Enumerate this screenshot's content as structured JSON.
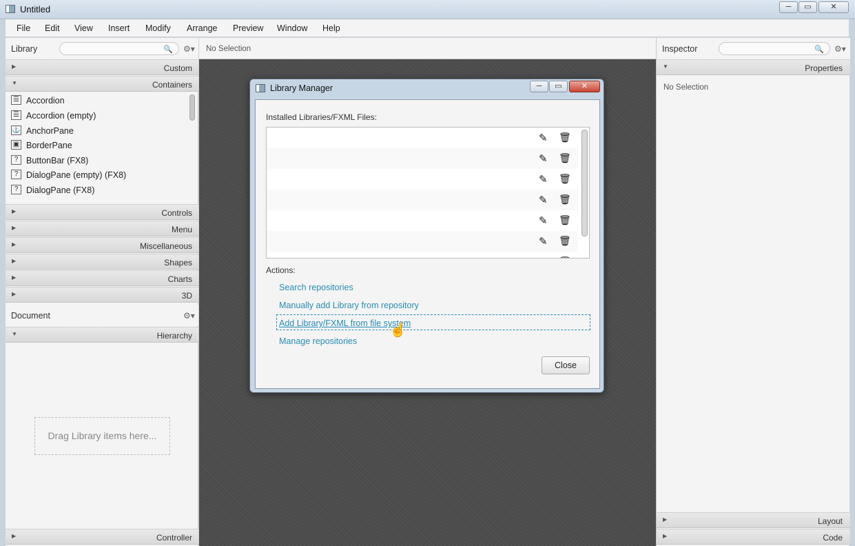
{
  "window": {
    "title": "Untitled",
    "minimize_glyph": "─",
    "maximize_glyph": "▭",
    "close_glyph": "✕"
  },
  "menubar": [
    "File",
    "Edit",
    "View",
    "Insert",
    "Modify",
    "Arrange",
    "Preview",
    "Window",
    "Help"
  ],
  "library": {
    "title": "Library",
    "search_placeholder": "",
    "sections": {
      "custom": "Custom",
      "containers": "Containers",
      "controls": "Controls",
      "menu": "Menu",
      "miscellaneous": "Miscellaneous",
      "shapes": "Shapes",
      "charts": "Charts",
      "threed": "3D"
    },
    "items": [
      {
        "icon": "accordion-icon",
        "glyph": "☰",
        "label": "Accordion"
      },
      {
        "icon": "accordion-icon",
        "glyph": "☰",
        "label": "Accordion  (empty)"
      },
      {
        "icon": "anchor-icon",
        "glyph": "⚓",
        "label": "AnchorPane"
      },
      {
        "icon": "borderpane-icon",
        "glyph": "▣",
        "label": "BorderPane"
      },
      {
        "icon": "unknown-icon",
        "glyph": "?",
        "label": "ButtonBar  (FX8)"
      },
      {
        "icon": "unknown-icon",
        "glyph": "?",
        "label": "DialogPane (empty)  (FX8)"
      },
      {
        "icon": "unknown-icon",
        "glyph": "?",
        "label": "DialogPane  (FX8)"
      }
    ]
  },
  "document": {
    "title": "Document",
    "hierarchy": "Hierarchy",
    "drop_hint": "Drag Library items here...",
    "controller": "Controller"
  },
  "center": {
    "selection": "No Selection"
  },
  "inspector": {
    "title": "Inspector",
    "properties": "Properties",
    "no_selection": "No Selection",
    "layout": "Layout",
    "code": "Code"
  },
  "dialog": {
    "title": "Library Manager",
    "installed_label": "Installed Libraries/FXML Files:",
    "actions_label": "Actions:",
    "links": {
      "search": "Search repositories",
      "manual": "Manually add Library from repository",
      "file": "Add Library/FXML from file system",
      "manage": "Manage repositories"
    },
    "close_label": "Close",
    "row_count": 6
  },
  "icons": {
    "edit": "✎",
    "delete": "🗑",
    "search": "🔍",
    "gear": "⚙▾",
    "collapsed": "▶",
    "expanded": "▼",
    "cursor": "☝"
  }
}
